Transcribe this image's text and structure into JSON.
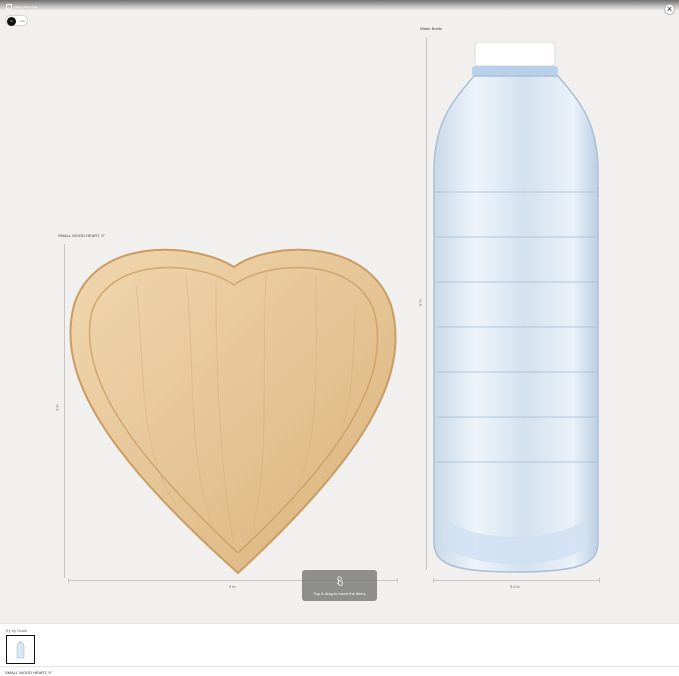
{
  "header": {
    "logo_text": "Pottery Barn Kids",
    "units": {
      "inches": "in",
      "centimeters": "cm",
      "selected": "in"
    },
    "close_icon": "close-icon"
  },
  "items": [
    {
      "label": "SMALL WOOD HEART, 9\"",
      "width_label": "9 in",
      "height_label": "9 in"
    },
    {
      "label": "Water Bottle",
      "height_label": "9 in",
      "width_label": "3.5 in"
    }
  ],
  "hint": {
    "icon": "touch-drag-icon",
    "text": "Tap & drag to move the items"
  },
  "tray": {
    "title": "Try by Scale",
    "thumbnail_icon": "water-bottle-thumbnail",
    "selected_name": "SMALL WOOD HEART, 9\""
  },
  "colors": {
    "background": "#f2f0ee",
    "wood": "#e6c79a",
    "bottle": "#d7e6f2",
    "cap": "#ffffff"
  }
}
